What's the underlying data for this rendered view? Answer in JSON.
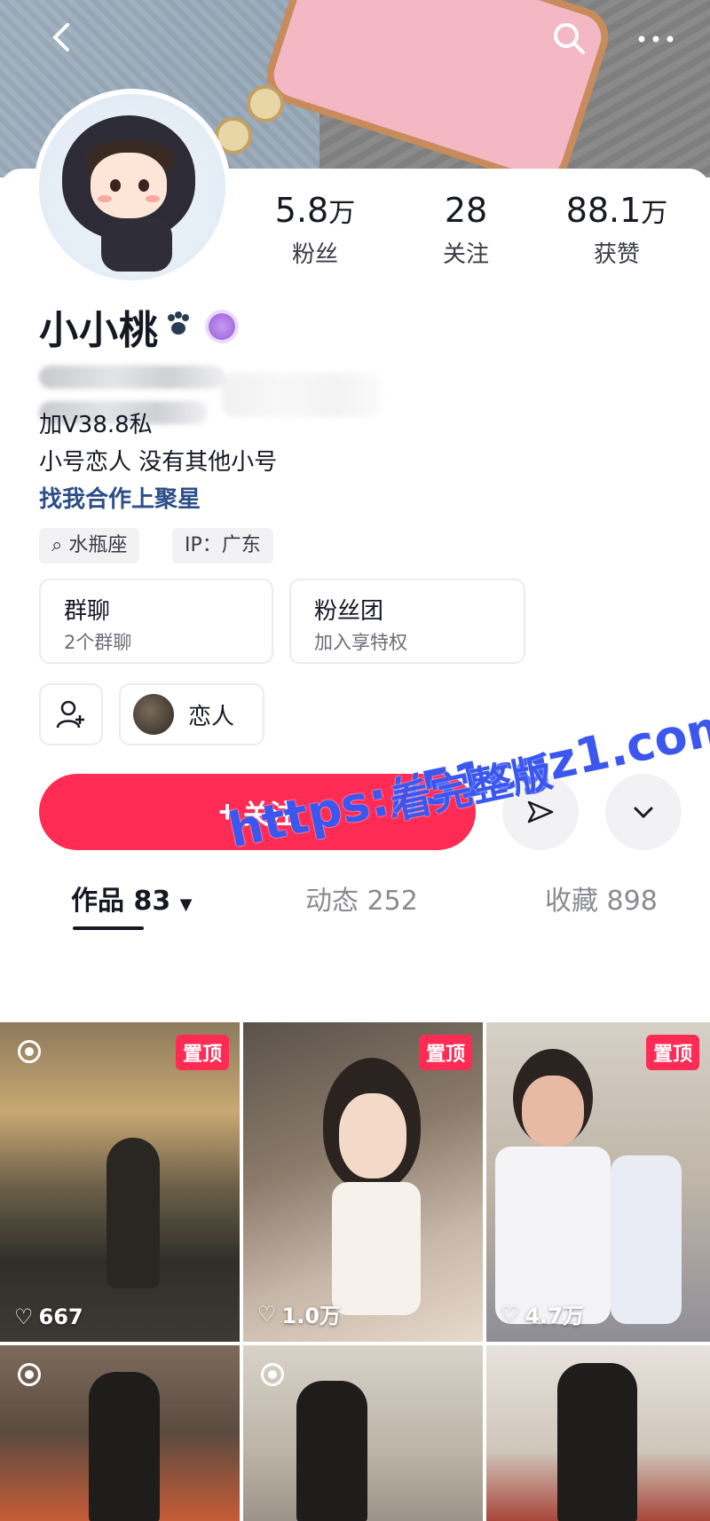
{
  "nav": {
    "back_icon": "back-arrow-icon",
    "search_icon": "search-icon",
    "more_icon": "more-icon"
  },
  "profile": {
    "name": "小小桃",
    "stats": [
      {
        "value": "5.8",
        "unit": "万",
        "label": "粉丝"
      },
      {
        "value": "28",
        "unit": "",
        "label": "关注"
      },
      {
        "value": "88.1",
        "unit": "万",
        "label": "获赞"
      }
    ],
    "bio": [
      "加V38.8私",
      "小号恋人 没有其他小号"
    ],
    "bio_link": "找我合作上聚星",
    "tags": [
      "水瓶座",
      "IP：广东"
    ],
    "group_chat": {
      "title": "群聊",
      "sub": "2个群聊"
    },
    "fan_club": {
      "title": "粉丝团",
      "sub": "加入享特权"
    },
    "lover_chip": "恋人"
  },
  "actions": {
    "follow_label": "关注"
  },
  "tabs": [
    {
      "label": "作品",
      "count": "83"
    },
    {
      "label": "动态",
      "count": "252"
    },
    {
      "label": "收藏",
      "count": "898"
    }
  ],
  "videos": [
    {
      "pinned": "置顶",
      "likes": "667"
    },
    {
      "pinned": "置顶",
      "likes": "1.0万"
    },
    {
      "pinned": "置顶",
      "likes": "4.7万"
    }
  ],
  "watermark": {
    "line1": "https://51cgz1.com",
    "line2": "看完整版"
  },
  "colors": {
    "accent": "#fe2c55",
    "link": "#2b4d8a",
    "watermark": "#3b57f0"
  }
}
